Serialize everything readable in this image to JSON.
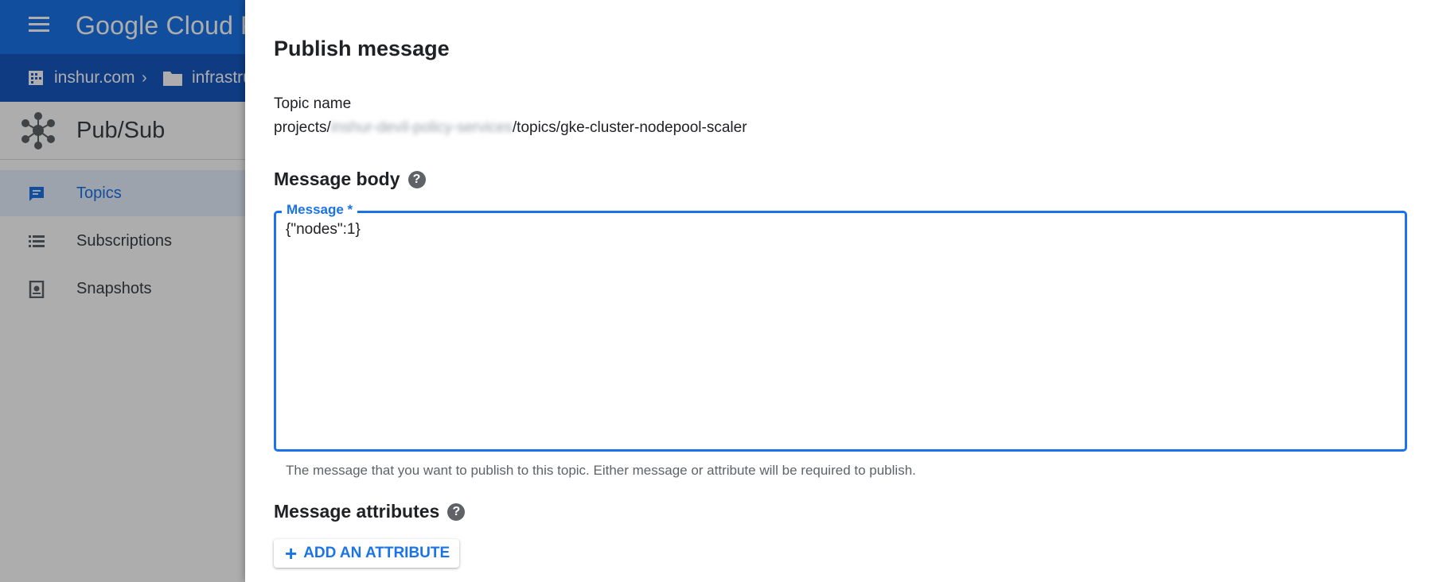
{
  "console": {
    "brand": "Google Cloud Pla",
    "breadcrumb": {
      "org": "inshur.com",
      "folder": "infrastru"
    },
    "product": "Pub/Sub",
    "nav": [
      {
        "label": "Topics",
        "icon": "topics-icon",
        "active": true
      },
      {
        "label": "Subscriptions",
        "icon": "list-icon",
        "active": false
      },
      {
        "label": "Snapshots",
        "icon": "snapshot-icon",
        "active": false
      }
    ]
  },
  "dialog": {
    "title": "Publish message",
    "topic_label": "Topic name",
    "topic_prefix": "projects/",
    "topic_blurred": "inshur-devil-policy-services",
    "topic_suffix": "/topics/gke-cluster-nodepool-scaler",
    "body_heading": "Message body",
    "message_label": "Message *",
    "message_value": "{\"nodes\":1}",
    "message_hint": "The message that you want to publish to this topic. Either message or attribute will be required to publish.",
    "attributes_heading": "Message attributes",
    "add_attribute_label": "ADD AN ATTRIBUTE",
    "help_icon": "help-icon"
  },
  "colors": {
    "primary": "#1a73e8",
    "topbar": "#1a73e8",
    "crumbbar": "#1557c0"
  }
}
